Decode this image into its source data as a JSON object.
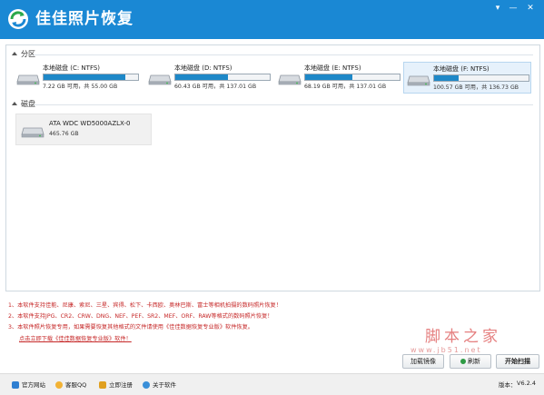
{
  "app": {
    "title": "佳佳照片恢复"
  },
  "window_controls": {
    "menu": "▾",
    "minimize": "—",
    "close": "✕"
  },
  "sections": {
    "partitions": "分区",
    "disks": "磁盘"
  },
  "partitions": [
    {
      "name": "本地磁盘 (C: NTFS)",
      "info": "7.22 GB 可用，共 55.00 GB",
      "used_pct": 87,
      "selected": false
    },
    {
      "name": "本地磁盘 (D: NTFS)",
      "info": "60.43 GB 可用，共 137.01 GB",
      "used_pct": 56,
      "selected": false
    },
    {
      "name": "本地磁盘 (E: NTFS)",
      "info": "68.19 GB 可用，共 137.01 GB",
      "used_pct": 50,
      "selected": false
    },
    {
      "name": "本地磁盘 (F: NTFS)",
      "info": "100.57 GB 可用，共 136.73 GB",
      "used_pct": 26,
      "selected": true
    }
  ],
  "disk": {
    "name": "ATA WDC WD5000AZLX-0",
    "size": "465.76 GB"
  },
  "notes": [
    "1、本软件支持佳能、尼康、索尼、三星、宾得、松下、卡西欧、奥林巴斯、富士等相机拍摄的数码照片恢复！",
    "2、本软件支持JPG、CR2、CRW、DNG、NEF、PEF、SR2、MEF、ORF、RAW等格式的数码照片恢复！",
    "3、本软件照片恢复专用，如果需要恢复其他格式的文件请使用《佳佳数据恢复专业版》软件恢复。"
  ],
  "download_link": "点击立即下载《佳佳数据恢复专业版》软件！",
  "watermark": {
    "cn": "脚本之家",
    "url": "www.jb51.net"
  },
  "buttons": {
    "load_image": "加载镜像",
    "refresh": "刷新",
    "start_scan": "开始扫描"
  },
  "footer": {
    "website": "官方网站",
    "qq": "客服QQ",
    "register": "立即注册",
    "about": "关于软件",
    "version_label": "版本：",
    "version": "V6.2.4"
  },
  "colors": {
    "title_bar": "#1a88d4",
    "progress": "#1e88c8",
    "note_text": "#c62828"
  }
}
